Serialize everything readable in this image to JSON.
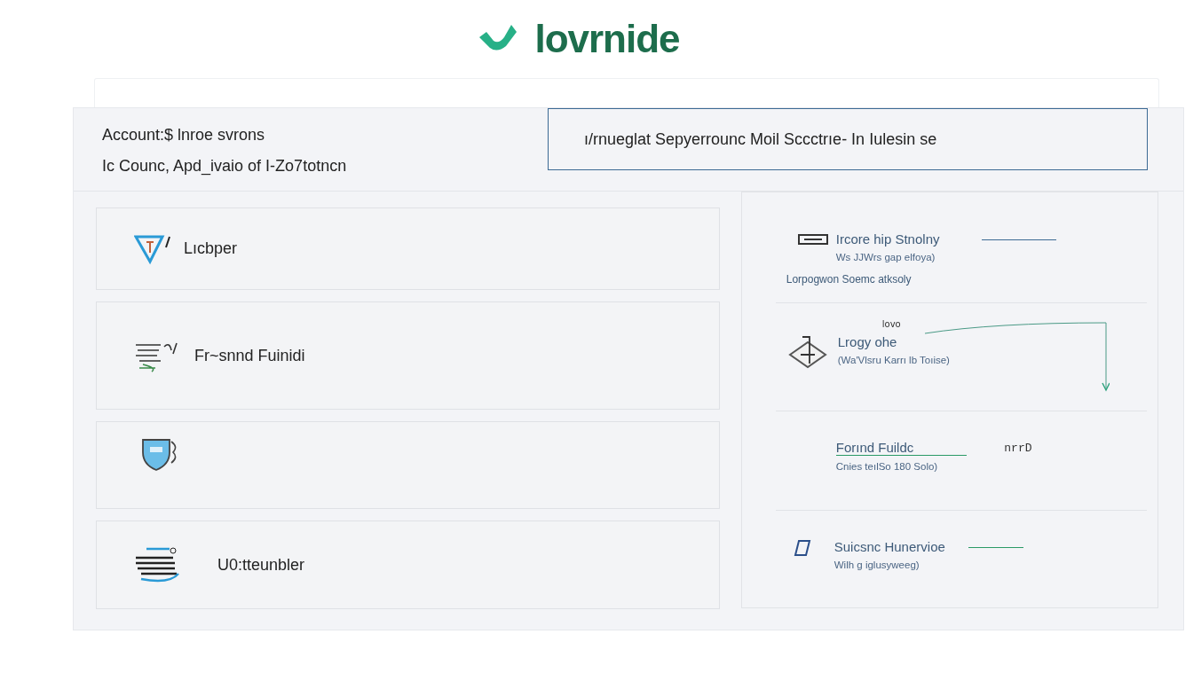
{
  "logo": {
    "text": "lovrnide"
  },
  "header": {
    "title": "Account:$ lnroe svrons",
    "subtitle": "Ic  Counc, Apd_ivaio of I-Zo7totncn"
  },
  "banner": {
    "text": "ı/rnueglat Sepyerrounc  Moil Scсctrıe- In  Iulesin se"
  },
  "cards": [
    {
      "kind": "labeled",
      "label": "Lıcbper"
    },
    {
      "kind": "labeled",
      "label": "Fr~snnd Fuinidi"
    },
    {
      "kind": "icon"
    },
    {
      "kind": "labeled",
      "label": "U0:tteunbler"
    }
  ],
  "sections": [
    {
      "title": "Ircore hip Stnolny",
      "subtitle": "Ws JJWrs gap elfoya)",
      "note": "Lorpogwon Soemc atksoly"
    },
    {
      "tag": "lovo",
      "title": "Lrogy ohe",
      "subtitle": "(Wa'Vlsru Karrı lb Toıise)"
    },
    {
      "title": "Forınd Fuildc",
      "subtitle": "Cnies teılSo 180 Solo)",
      "mark": "nrrD"
    },
    {
      "title": "Suicsnc Hunervioe",
      "subtitle": "Wilh g iglusyweeg)"
    }
  ]
}
